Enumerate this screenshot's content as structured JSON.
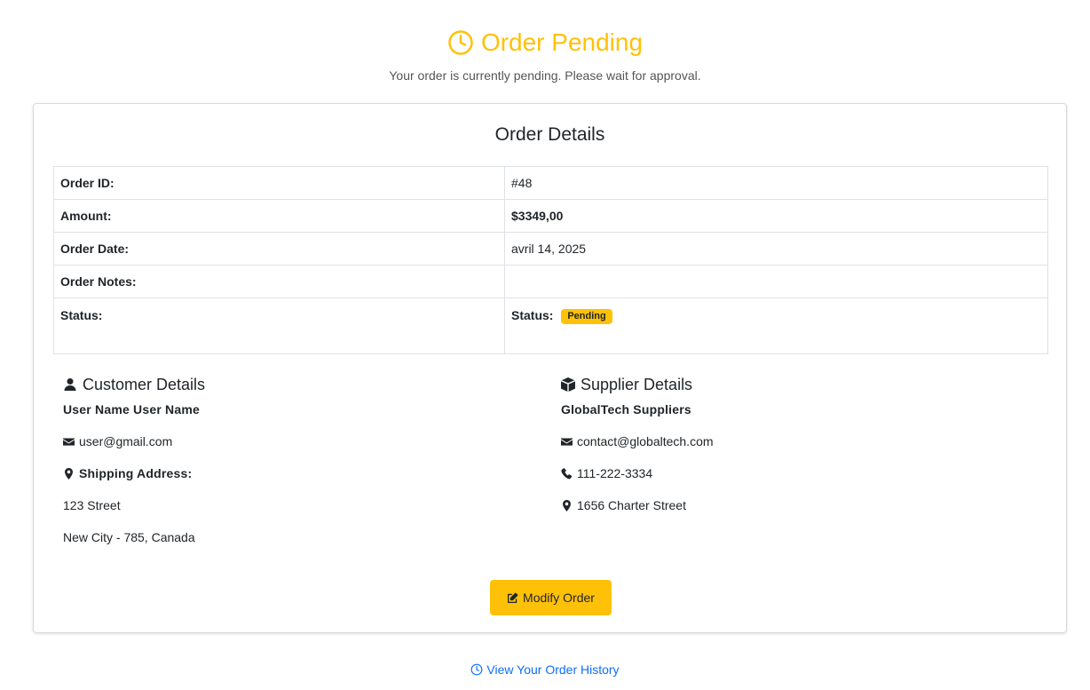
{
  "header": {
    "title": "Order Pending",
    "subtitle": "Your order is currently pending. Please wait for approval.",
    "accent_color": "#ffc107",
    "icon": "clock-icon"
  },
  "order_details": {
    "title": "Order Details",
    "rows": [
      {
        "label": "Order ID:",
        "value": "#48"
      },
      {
        "label": "Amount:",
        "value": "$3349,00"
      },
      {
        "label": "Order Date:",
        "value": "avril 14, 2025"
      },
      {
        "label": "Order Notes:",
        "value": ""
      }
    ],
    "status": {
      "label": "Status:",
      "inner_label": "Status:",
      "badge": "Pending",
      "badge_color": "#ffc107"
    }
  },
  "customer": {
    "heading": "Customer Details",
    "icon": "user-icon",
    "name": "User Name User Name",
    "email": "user@gmail.com",
    "shipping_label": "Shipping Address:",
    "address_line1": "123 Street",
    "address_line2": "New City - 785, Canada"
  },
  "supplier": {
    "heading": "Supplier Details",
    "icon": "box-icon",
    "name": "GlobalTech Suppliers",
    "email": "contact@globaltech.com",
    "phone": "111-222-3334",
    "address": "1656 Charter Street"
  },
  "actions": {
    "modify_label": "Modify Order",
    "modify_icon": "edit-icon",
    "history_label": "View Your Order History",
    "history_icon": "clock-icon",
    "link_color": "#0d6efd"
  }
}
